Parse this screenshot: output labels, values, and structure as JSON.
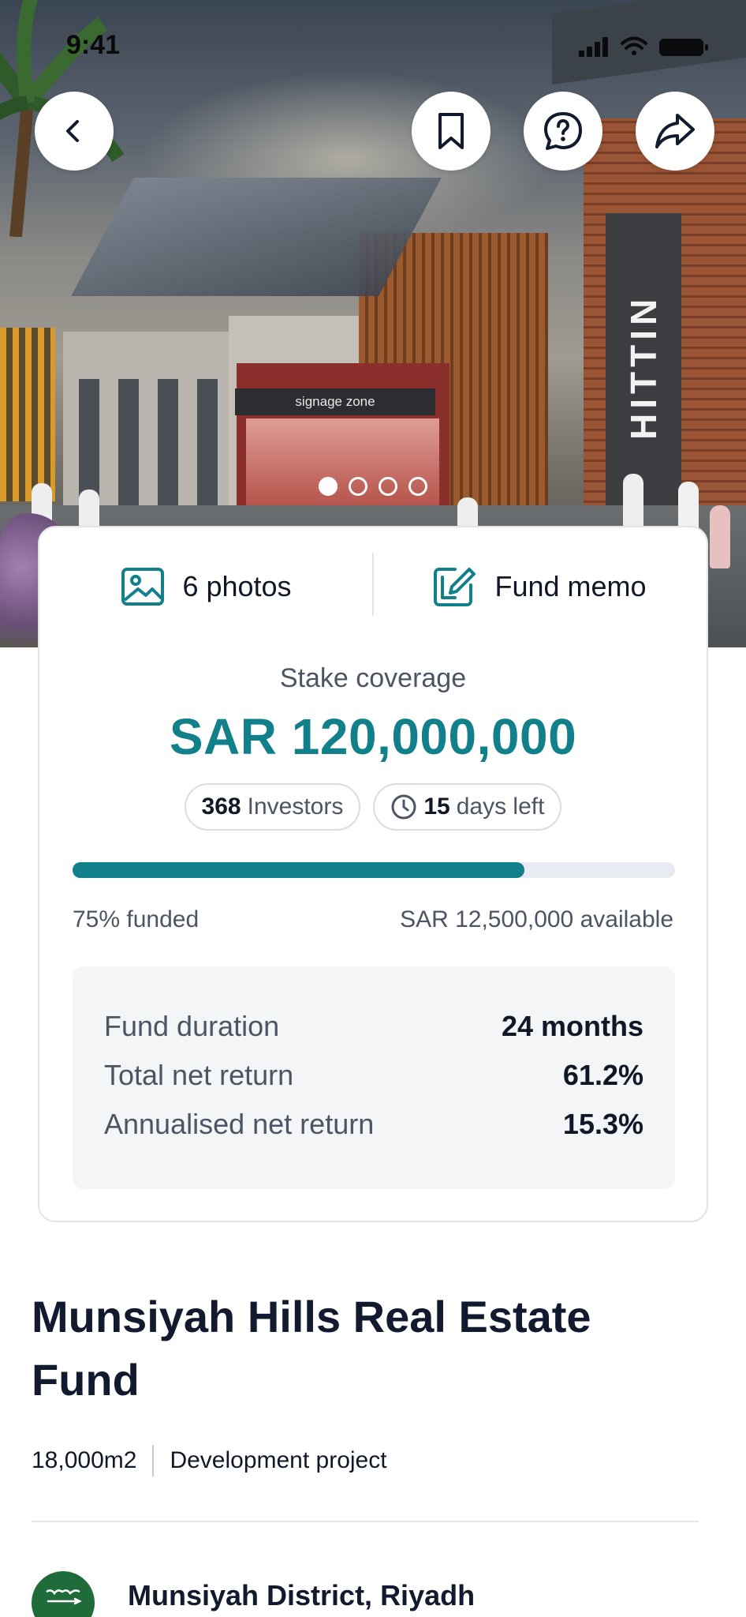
{
  "status_bar": {
    "time": "9:41"
  },
  "hero": {
    "building_signage": "signage zone",
    "building_name": "HITTIN",
    "carousel": {
      "total": 4,
      "active_index": 0
    }
  },
  "top_actions": {
    "back_icon": "chevron-left-icon",
    "bookmark_icon": "bookmark-icon",
    "help_icon": "help-circle-icon",
    "share_icon": "share-arrow-icon"
  },
  "card": {
    "photos_label": "6 photos",
    "fund_memo_label": "Fund memo",
    "coverage_label": "Stake coverage",
    "coverage_amount": "SAR 120,000,000",
    "investors_count": "368",
    "investors_label": "Investors",
    "days_count": "15",
    "days_label": "days left",
    "funded_fraction": 0.75,
    "funded_label": "75% funded",
    "available_label": "SAR 12,500,000 available",
    "stats": [
      {
        "label": "Fund duration",
        "value": "24 months"
      },
      {
        "label": "Total net return",
        "value": "61.2%"
      },
      {
        "label": "Annualised net return",
        "value": "15.3%"
      }
    ]
  },
  "fund": {
    "title": "Munsiyah Hills Real Estate Fund",
    "area": "18,000m2",
    "project_type": "Development project",
    "location": "Munsiyah District, Riyadh"
  },
  "colors": {
    "accent": "#12808a",
    "progress_track": "#e8ebf1",
    "flag_green": "#1f6b3a"
  }
}
